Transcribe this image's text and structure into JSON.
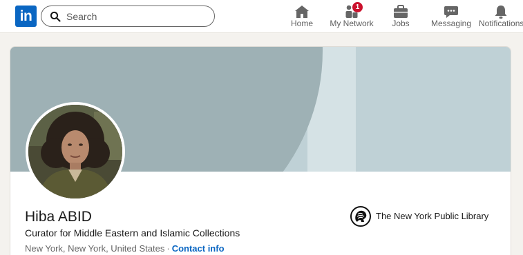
{
  "brand": {
    "logo_text": "in",
    "color": "#0a66c2"
  },
  "search": {
    "placeholder": "Search",
    "value": ""
  },
  "nav": {
    "items": [
      {
        "label": "Home",
        "icon": "home-icon"
      },
      {
        "label": "My Network",
        "icon": "network-icon",
        "badge": "1"
      },
      {
        "label": "Jobs",
        "icon": "briefcase-icon"
      },
      {
        "label": "Messaging",
        "icon": "messaging-icon"
      },
      {
        "label": "Notifications",
        "icon": "bell-icon"
      }
    ]
  },
  "profile": {
    "name": "Hiba ABID",
    "headline": "Curator for Middle Eastern and Islamic Collections",
    "location": "New York, New York, United States",
    "separator": "·",
    "contact_link": "Contact info",
    "organization": "The New York Public Library"
  },
  "colors": {
    "accent": "#0a66c2",
    "badge": "#cb112d",
    "banner": "#9eb1b5"
  }
}
